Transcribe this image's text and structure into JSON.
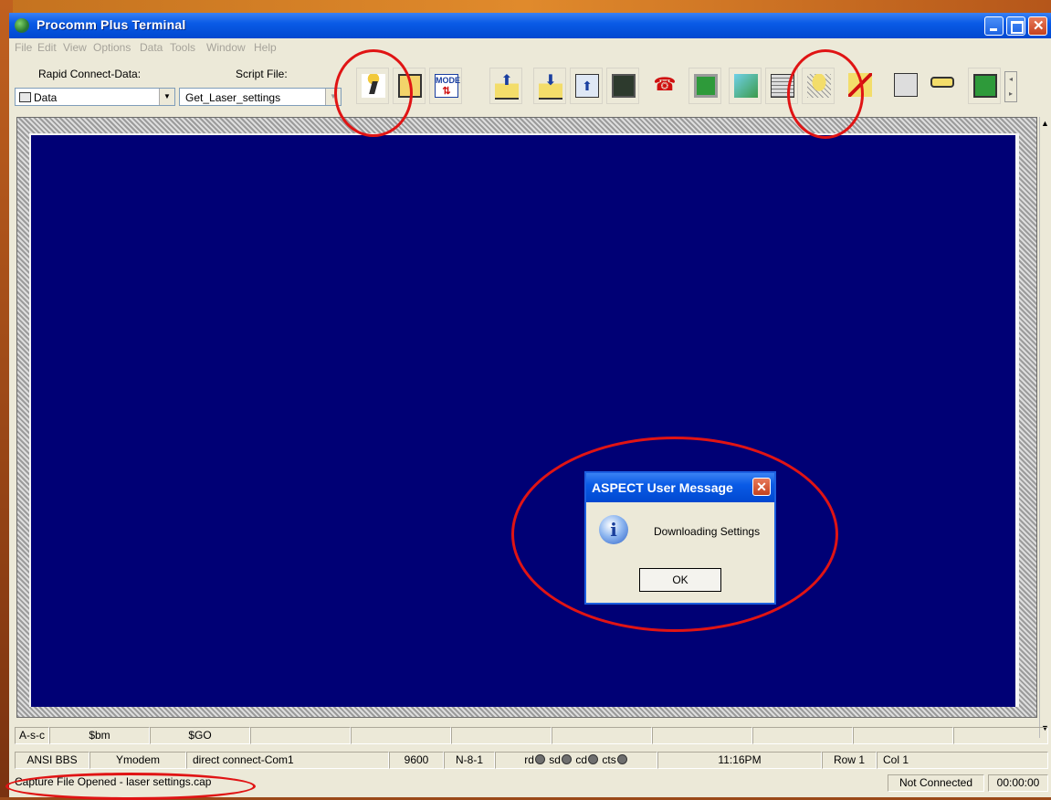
{
  "window": {
    "title": "Procomm Plus Terminal"
  },
  "menu": [
    "File",
    "Edit",
    "View",
    "Options",
    "Data",
    "Tools",
    "Window",
    "Help"
  ],
  "toolbar": {
    "rapid_connect_label": "Rapid Connect-Data:",
    "rapid_connect_value": "Data",
    "script_file_label": "Script File:",
    "script_file_value": "Get_Laser_settings"
  },
  "dialog": {
    "title": "ASPECT User Message",
    "message": "Downloading Settings",
    "ok_label": "OK"
  },
  "meta_keys": [
    "A-s-c",
    "$bm",
    "$GO",
    "",
    "",
    "",
    "",
    "",
    "",
    "",
    "",
    ""
  ],
  "status1": {
    "emulation": "ANSI BBS",
    "protocol": "Ymodem",
    "connection": "direct connect-Com1",
    "baud": "9600",
    "parity": "N-8-1",
    "rd": "rd",
    "sd": "sd",
    "cd": "cd",
    "cts": "cts",
    "time": "11:16PM",
    "row": "Row 1",
    "col": "Col 1"
  },
  "status2": {
    "message": "Capture File Opened - laser settings.cap",
    "connection_state": "Not Connected",
    "elapsed": "00:00:00"
  },
  "colors": {
    "terminal_bg": "#000075",
    "titlebar": "#0a5be6",
    "annotation": "#e01414"
  },
  "toolbar_icons": [
    "run-script-icon",
    "script-book-icon",
    "mode-icon",
    "upload-folder-icon",
    "download-folder-icon",
    "fax-upload-icon",
    "terminal-screen-icon",
    "phone-icon",
    "monitor-icon",
    "paperclip-icon",
    "printer-icon",
    "capture-net-icon",
    "cancel-tools-icon",
    "scanner-icon",
    "cable-icon",
    "meta-panel-icon"
  ]
}
